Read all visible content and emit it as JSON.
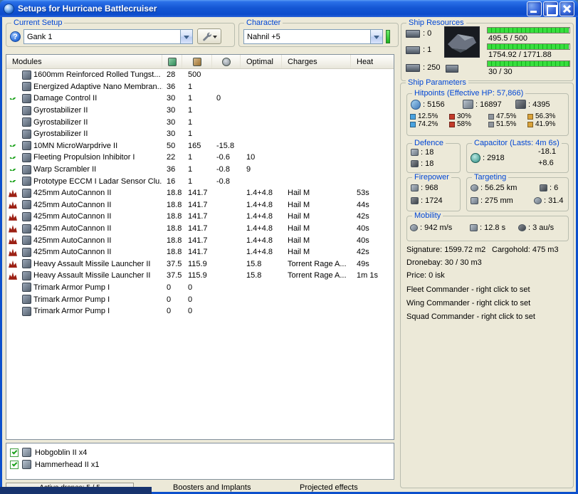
{
  "window": {
    "title": "Setups for Hurricane Battlecruiser"
  },
  "icons": {
    "help": "?"
  },
  "current_setup": {
    "label": "Current Setup",
    "selected": "Gank 1"
  },
  "character": {
    "label": "Character",
    "selected": "Nahnil +5"
  },
  "ship_resources": {
    "label": "Ship Resources",
    "turrets_free": ": 0",
    "launchers_free": ": 1",
    "calibration_free": ": 250",
    "cpu_text": "495.5 / 500",
    "cpu_pct": 99.1,
    "powergrid_text": "1754.92 / 1771.88",
    "powergrid_pct": 99,
    "dronebay_text": "30 / 30",
    "dronebay_pct": 100
  },
  "modules_table": {
    "header": {
      "modules": "Modules",
      "optimal": "Optimal",
      "charges": "Charges",
      "heat": "Heat"
    },
    "rows": [
      {
        "status": "none",
        "name": "1600mm Reinforced Rolled Tungst...",
        "cpu": "28",
        "pg": "500",
        "cap": "",
        "optimal": "",
        "charges": "",
        "heat": ""
      },
      {
        "status": "none",
        "name": "Energized Adaptive Nano Membran...",
        "cpu": "36",
        "pg": "1",
        "cap": "",
        "optimal": "",
        "charges": "",
        "heat": ""
      },
      {
        "status": "check",
        "name": "Damage Control II",
        "cpu": "30",
        "pg": "1",
        "cap": "0",
        "optimal": "",
        "charges": "",
        "heat": ""
      },
      {
        "status": "none",
        "name": "Gyrostabilizer II",
        "cpu": "30",
        "pg": "1",
        "cap": "",
        "optimal": "",
        "charges": "",
        "heat": ""
      },
      {
        "status": "none",
        "name": "Gyrostabilizer II",
        "cpu": "30",
        "pg": "1",
        "cap": "",
        "optimal": "",
        "charges": "",
        "heat": ""
      },
      {
        "status": "none",
        "name": "Gyrostabilizer II",
        "cpu": "30",
        "pg": "1",
        "cap": "",
        "optimal": "",
        "charges": "",
        "heat": ""
      },
      {
        "status": "check",
        "name": "10MN MicroWarpdrive II",
        "cpu": "50",
        "pg": "165",
        "cap": "-15.8",
        "optimal": "",
        "charges": "",
        "heat": ""
      },
      {
        "status": "check",
        "name": "Fleeting Propulsion Inhibitor I",
        "cpu": "22",
        "pg": "1",
        "cap": "-0.6",
        "optimal": "10",
        "charges": "",
        "heat": ""
      },
      {
        "status": "check",
        "name": "Warp Scrambler II",
        "cpu": "36",
        "pg": "1",
        "cap": "-0.8",
        "optimal": "9",
        "charges": "",
        "heat": ""
      },
      {
        "status": "check",
        "name": "Prototype ECCM I Ladar Sensor Clu...",
        "cpu": "16",
        "pg": "1",
        "cap": "-0.8",
        "optimal": "",
        "charges": "",
        "heat": ""
      },
      {
        "status": "overheat",
        "name": "425mm AutoCannon II",
        "cpu": "18.8",
        "pg": "141.7",
        "cap": "",
        "optimal": "1.4+4.8",
        "charges": "Hail M",
        "heat": "53s"
      },
      {
        "status": "overheat",
        "name": "425mm AutoCannon II",
        "cpu": "18.8",
        "pg": "141.7",
        "cap": "",
        "optimal": "1.4+4.8",
        "charges": "Hail M",
        "heat": "44s"
      },
      {
        "status": "overheat",
        "name": "425mm AutoCannon II",
        "cpu": "18.8",
        "pg": "141.7",
        "cap": "",
        "optimal": "1.4+4.8",
        "charges": "Hail M",
        "heat": "42s"
      },
      {
        "status": "overheat",
        "name": "425mm AutoCannon II",
        "cpu": "18.8",
        "pg": "141.7",
        "cap": "",
        "optimal": "1.4+4.8",
        "charges": "Hail M",
        "heat": "40s"
      },
      {
        "status": "overheat",
        "name": "425mm AutoCannon II",
        "cpu": "18.8",
        "pg": "141.7",
        "cap": "",
        "optimal": "1.4+4.8",
        "charges": "Hail M",
        "heat": "40s"
      },
      {
        "status": "overheat",
        "name": "425mm AutoCannon II",
        "cpu": "18.8",
        "pg": "141.7",
        "cap": "",
        "optimal": "1.4+4.8",
        "charges": "Hail M",
        "heat": "42s"
      },
      {
        "status": "overheat",
        "name": "Heavy Assault Missile Launcher II",
        "cpu": "37.5",
        "pg": "115.9",
        "cap": "",
        "optimal": "15.8",
        "charges": "Torrent Rage A...",
        "heat": "49s"
      },
      {
        "status": "overheat",
        "name": "Heavy Assault Missile Launcher II",
        "cpu": "37.5",
        "pg": "115.9",
        "cap": "",
        "optimal": "15.8",
        "charges": "Torrent Rage A...",
        "heat": "1m 1s"
      },
      {
        "status": "none",
        "name": "Trimark Armor Pump I",
        "cpu": "0",
        "pg": "0",
        "cap": "",
        "optimal": "",
        "charges": "",
        "heat": ""
      },
      {
        "status": "none",
        "name": "Trimark Armor Pump I",
        "cpu": "0",
        "pg": "0",
        "cap": "",
        "optimal": "",
        "charges": "",
        "heat": ""
      },
      {
        "status": "none",
        "name": "Trimark Armor Pump I",
        "cpu": "0",
        "pg": "0",
        "cap": "",
        "optimal": "",
        "charges": "",
        "heat": ""
      }
    ]
  },
  "drones": {
    "items": [
      {
        "name": "Hobgoblin II x4"
      },
      {
        "name": "Hammerhead II x1"
      }
    ]
  },
  "bottom_bar": {
    "active_drones": "Active drones: 5 / 5",
    "boosters": "Boosters and Implants",
    "projected": "Projected effects"
  },
  "ship_parameters": {
    "label": "Ship Parameters",
    "hitpoints": {
      "label": "Hitpoints (Effective HP: 57,866)",
      "shield": ": 5156",
      "armor": ": 16897",
      "hull": ": 4395",
      "resists": [
        {
          "type": "em",
          "shield": "12.5%",
          "armor": "74.2%"
        },
        {
          "type": "thermal",
          "shield": "30%",
          "armor": "58%"
        },
        {
          "type": "kinetic",
          "shield": "47.5%",
          "armor": "51.5%"
        },
        {
          "type": "explosive",
          "shield": "56.3%",
          "armor": "41.9%"
        }
      ]
    },
    "defence": {
      "label": "Defence",
      "value1": ": 18",
      "value2": ": 18"
    },
    "capacitor": {
      "label": "Capacitor (Lasts: 4m 6s)",
      "amount": ": 2918",
      "out": "-18.1",
      "in": "+8.6"
    },
    "firepower": {
      "label": "Firepower",
      "volley": ": 968",
      "dps": ": 1724"
    },
    "targeting": {
      "label": "Targeting",
      "range": ": 56.25 km",
      "max_targets": ": 6",
      "scan_resolution": ": 275 mm",
      "sensor_strength": ": 31.4"
    },
    "mobility": {
      "label": "Mobility",
      "speed": ": 942 m/s",
      "align_time": ": 12.8 s",
      "warp_speed": ": 3 au/s"
    },
    "info_lines": {
      "signature": "Signature: 1599.72 m2",
      "cargohold": "Cargohold: 475 m3",
      "dronebay": "Dronebay: 30 / 30 m3",
      "price": "Price: 0 isk",
      "fleet": "Fleet Commander - right click to set",
      "wing": "Wing Commander - right click to set",
      "squad": "Squad Commander - right click to set"
    }
  }
}
